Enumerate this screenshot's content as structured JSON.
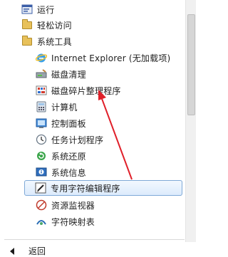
{
  "top_items": [
    {
      "label": "运行",
      "icon": "run-icon"
    },
    {
      "label": "轻松访问",
      "icon": "folder-icon"
    },
    {
      "label": "系统工具",
      "icon": "folder-icon"
    }
  ],
  "system_tools": [
    {
      "label": "Internet Explorer (无加载项)",
      "icon": "internet-explorer-icon"
    },
    {
      "label": "磁盘清理",
      "icon": "disk-cleanup-icon"
    },
    {
      "label": "磁盘碎片整理程序",
      "icon": "disk-defragmenter-icon"
    },
    {
      "label": "计算机",
      "icon": "computer-icon"
    },
    {
      "label": "控制面板",
      "icon": "control-panel-icon"
    },
    {
      "label": "任务计划程序",
      "icon": "task-scheduler-icon"
    },
    {
      "label": "系统还原",
      "icon": "system-restore-icon"
    },
    {
      "label": "系统信息",
      "icon": "system-info-icon"
    },
    {
      "label": "专用字符编辑程序",
      "icon": "private-character-editor-icon"
    },
    {
      "label": "资源监视器",
      "icon": "resource-monitor-icon"
    },
    {
      "label": "字符映射表",
      "icon": "character-map-icon"
    }
  ],
  "highlighted_item": "专用字符编辑程序",
  "back_label": "返回",
  "colors": {
    "accent": "#cde4fb",
    "annotation_arrow": "#e0202a"
  }
}
